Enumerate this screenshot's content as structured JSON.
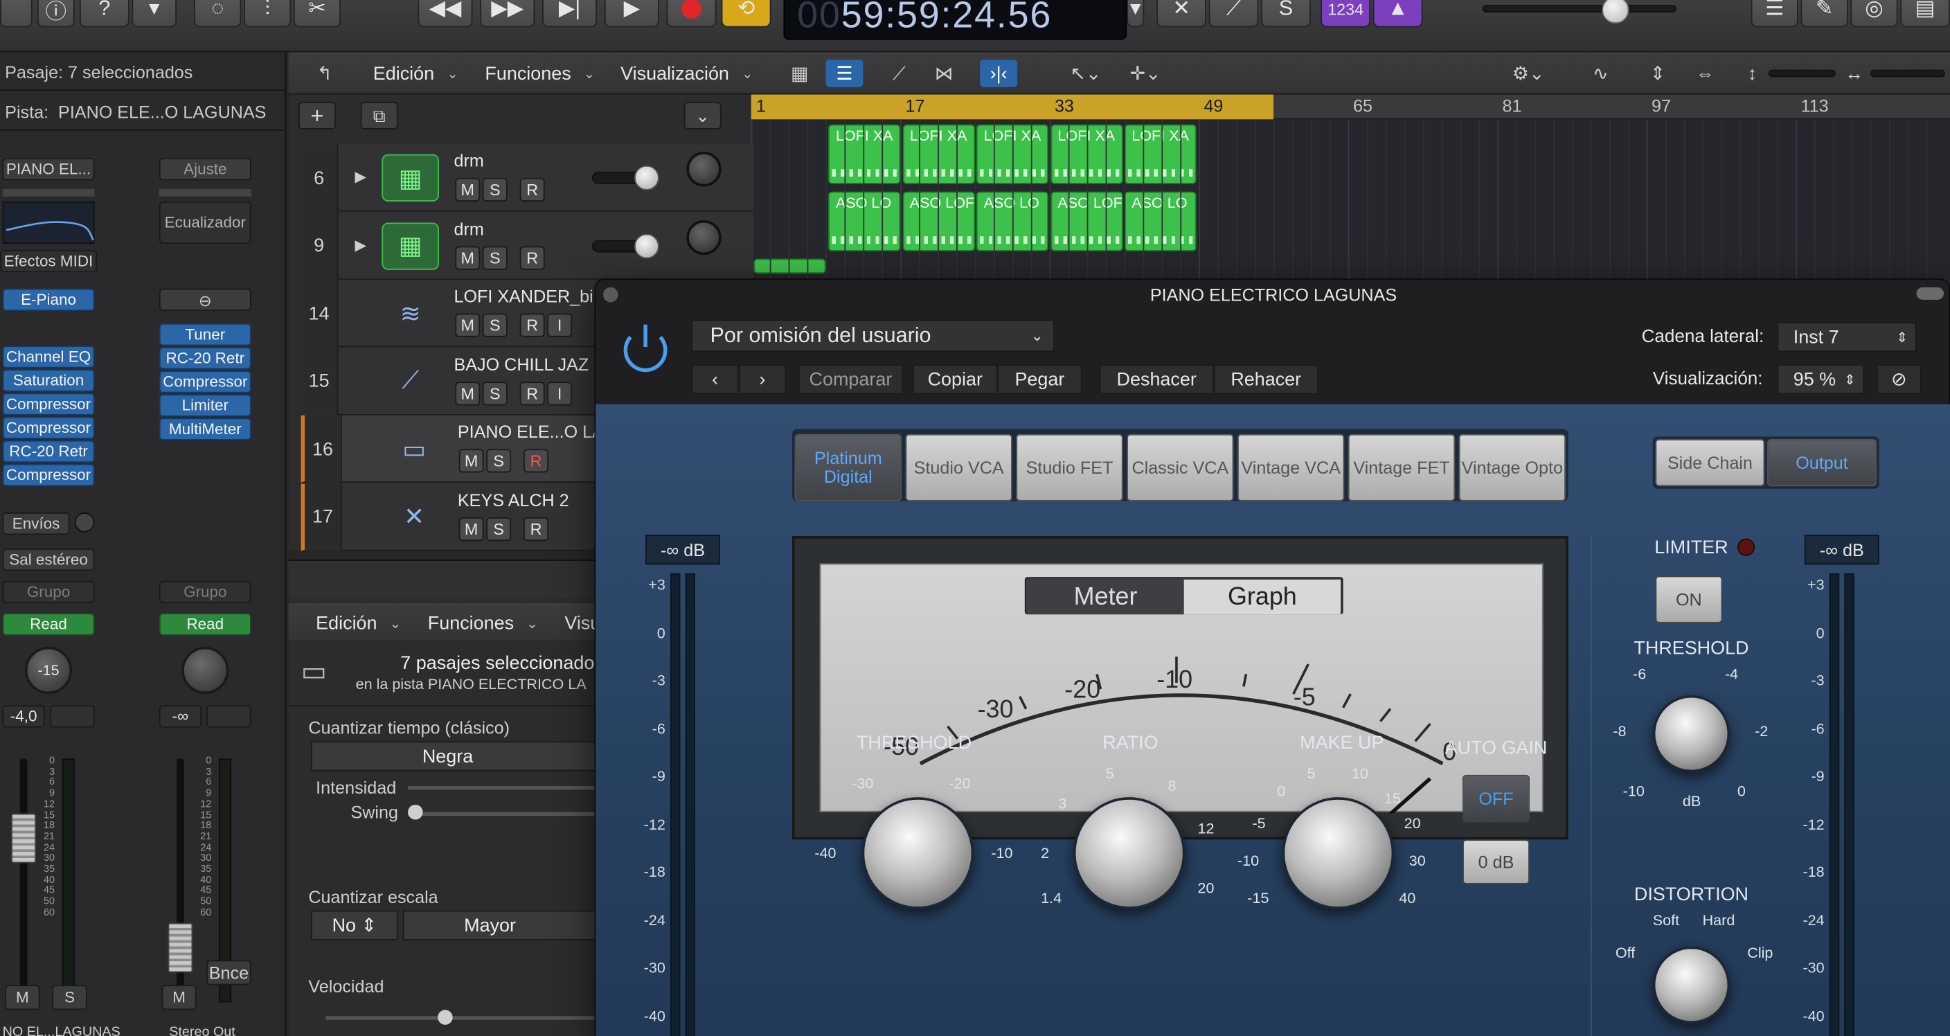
{
  "topbar": {
    "lcd_dim": "00",
    "lcd_time": "59:59:24.56",
    "count_in": "1234",
    "s_label": "S"
  },
  "inspector": {
    "pasaje_label": "Pasaje:",
    "pasaje_value": "7 seleccionados",
    "pista_label": "Pista:",
    "pista_value": "PIANO ELE...O LAGUNAS",
    "strip1": {
      "name": "PIANO EL...",
      "eq": "",
      "midi": "Efectos MIDI",
      "instrument": "E-Piano",
      "plugins": [
        "Channel EQ",
        "Saturation",
        "Compressor",
        "Compressor",
        "RC-20 Retr",
        "Compressor"
      ],
      "sends": "Envíos",
      "output": "Sal estéreo",
      "group": "Grupo",
      "automation": "Read",
      "pan": "-15",
      "volume": "-4,0",
      "mute": "M",
      "solo": "S",
      "bottom": "NO EL...LAGUNAS"
    },
    "strip2": {
      "name": "Ajuste",
      "eq": "Ecualizador",
      "plugins": [
        "Tuner",
        "RC-20 Retr",
        "Compressor",
        "Limiter",
        "MultiMeter"
      ],
      "group": "Grupo",
      "automation": "Read",
      "volume": "-∞",
      "mute": "M",
      "bounce": "Bnce",
      "bottom": "Stereo Out"
    },
    "fader_scale": [
      "0",
      "3",
      "6",
      "9",
      "12",
      "15",
      "18",
      "21",
      "24",
      "30",
      "35",
      "40",
      "45",
      "50",
      "60"
    ]
  },
  "tracks_toolbar": {
    "edit": "Edición",
    "functions": "Funciones",
    "view": "Visualización"
  },
  "ruler": [
    "1",
    "17",
    "33",
    "49",
    "65",
    "81",
    "97",
    "113"
  ],
  "tracks": [
    {
      "num": "6",
      "name": "drm",
      "m": "M",
      "s": "S",
      "r": "R"
    },
    {
      "num": "9",
      "name": "drm",
      "m": "M",
      "s": "S",
      "r": "R"
    },
    {
      "num": "14",
      "name": "LOFI XANDER_bi",
      "m": "M",
      "s": "S",
      "r": "R",
      "i": "I"
    },
    {
      "num": "15",
      "name": "BAJO CHILL JAZ",
      "m": "M",
      "s": "S",
      "r": "R",
      "i": "I"
    },
    {
      "num": "16",
      "name": "PIANO ELE...O LA",
      "m": "M",
      "s": "S",
      "r": "R"
    },
    {
      "num": "17",
      "name": "KEYS ALCH 2",
      "m": "M",
      "s": "S",
      "r": "R"
    }
  ],
  "regions_row1": [
    "LOFI XA",
    "LOFI XA",
    "LOFI XA",
    "LOFI XA",
    "LOFI XA"
  ],
  "regions_row2": [
    "ASO LO",
    "ASO LOF",
    "ASO LO",
    "ASO LOF",
    "ASO LO"
  ],
  "editor": {
    "edit": "Edición",
    "functions": "Funciones",
    "view": "Visu",
    "selected": "7 pasajes seleccionado",
    "on_track": "en la pista PIANO ELECTRICO LA",
    "quant_label": "Cuantizar tiempo (clásico)",
    "quant_value": "Negra",
    "strength": "Intensidad",
    "swing": "Swing",
    "scale_label": "Cuantizar escala",
    "scale_no": "No",
    "scale_mode": "Mayor",
    "velocity": "Velocidad"
  },
  "plugin": {
    "title": "PIANO ELECTRICO LAGUNAS",
    "preset": "Por omisión del usuario",
    "compare": "Comparar",
    "copy": "Copiar",
    "paste": "Pegar",
    "undo": "Deshacer",
    "redo": "Rehacer",
    "sidechain_label": "Cadena lateral:",
    "sidechain_value": "Inst 7",
    "view_label": "Visualización:",
    "view_value": "95 %",
    "models": [
      "Platinum Digital",
      "Studio VCA",
      "Studio FET",
      "Classic VCA",
      "Vintage VCA",
      "Vintage FET",
      "Vintage Opto"
    ],
    "side_chain": "Side Chain",
    "output": "Output",
    "meter_tab": "Meter",
    "graph_tab": "Graph",
    "vu_scale": [
      "-50",
      "-30",
      "-20",
      "-10",
      "-5",
      "0"
    ],
    "in_db": "-∞ dB",
    "out_db": "-∞ dB",
    "side_scale": [
      "+3",
      "0",
      "-3",
      "-6",
      "-9",
      "-12",
      "-18",
      "-24",
      "-30",
      "-40"
    ],
    "threshold": "THRESHOLD",
    "threshold_ticks": [
      "-30",
      "-20",
      "-40",
      "-10"
    ],
    "ratio": "RATIO",
    "ratio_ticks": [
      "5",
      "3",
      "8",
      "2",
      "12",
      "1.4",
      "20"
    ],
    "makeup": "MAKE UP",
    "makeup_ticks": [
      "5",
      "10",
      "0",
      "15",
      "-5",
      "20",
      "-10",
      "30",
      "-15",
      "40"
    ],
    "auto_gain": "AUTO GAIN",
    "auto_gain_off": "OFF",
    "zero_db": "0 dB",
    "limiter": "LIMITER",
    "limiter_on": "ON",
    "lim_threshold": "THRESHOLD",
    "lim_ticks": [
      "-6",
      "-4",
      "-8",
      "-2",
      "-10",
      "0"
    ],
    "lim_db": "dB",
    "distortion": "DISTORTION",
    "dist_ticks": [
      "Soft",
      "Hard",
      "Off",
      "Clip"
    ]
  }
}
